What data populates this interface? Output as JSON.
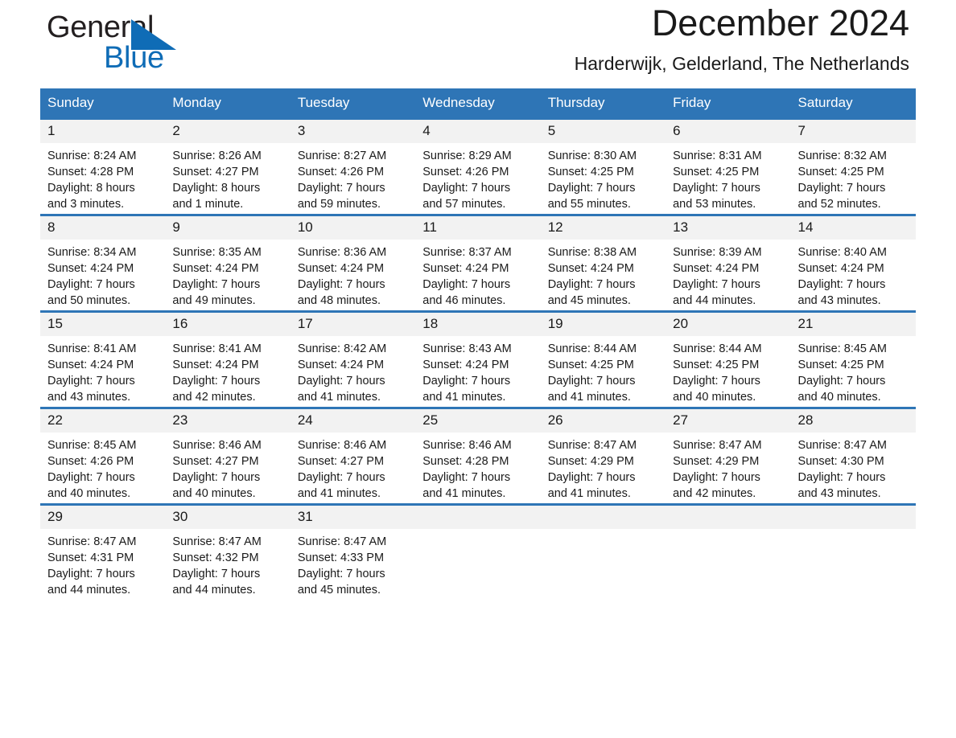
{
  "brand": {
    "line1": "General",
    "line2": "Blue",
    "triangle_color": "#0f6cb6",
    "text_color": "#231f20"
  },
  "header": {
    "title": "December 2024",
    "location": "Harderwijk, Gelderland, The Netherlands"
  },
  "theme": {
    "header_blue": "#2e75b6",
    "daynum_bg": "#f2f2f2",
    "text": "#1a1a1a"
  },
  "weekdays": [
    "Sunday",
    "Monday",
    "Tuesday",
    "Wednesday",
    "Thursday",
    "Friday",
    "Saturday"
  ],
  "weeks": [
    [
      {
        "day": "1",
        "sunrise": "Sunrise: 8:24 AM",
        "sunset": "Sunset: 4:28 PM",
        "daylight1": "Daylight: 8 hours",
        "daylight2": "and 3 minutes."
      },
      {
        "day": "2",
        "sunrise": "Sunrise: 8:26 AM",
        "sunset": "Sunset: 4:27 PM",
        "daylight1": "Daylight: 8 hours",
        "daylight2": "and 1 minute."
      },
      {
        "day": "3",
        "sunrise": "Sunrise: 8:27 AM",
        "sunset": "Sunset: 4:26 PM",
        "daylight1": "Daylight: 7 hours",
        "daylight2": "and 59 minutes."
      },
      {
        "day": "4",
        "sunrise": "Sunrise: 8:29 AM",
        "sunset": "Sunset: 4:26 PM",
        "daylight1": "Daylight: 7 hours",
        "daylight2": "and 57 minutes."
      },
      {
        "day": "5",
        "sunrise": "Sunrise: 8:30 AM",
        "sunset": "Sunset: 4:25 PM",
        "daylight1": "Daylight: 7 hours",
        "daylight2": "and 55 minutes."
      },
      {
        "day": "6",
        "sunrise": "Sunrise: 8:31 AM",
        "sunset": "Sunset: 4:25 PM",
        "daylight1": "Daylight: 7 hours",
        "daylight2": "and 53 minutes."
      },
      {
        "day": "7",
        "sunrise": "Sunrise: 8:32 AM",
        "sunset": "Sunset: 4:25 PM",
        "daylight1": "Daylight: 7 hours",
        "daylight2": "and 52 minutes."
      }
    ],
    [
      {
        "day": "8",
        "sunrise": "Sunrise: 8:34 AM",
        "sunset": "Sunset: 4:24 PM",
        "daylight1": "Daylight: 7 hours",
        "daylight2": "and 50 minutes."
      },
      {
        "day": "9",
        "sunrise": "Sunrise: 8:35 AM",
        "sunset": "Sunset: 4:24 PM",
        "daylight1": "Daylight: 7 hours",
        "daylight2": "and 49 minutes."
      },
      {
        "day": "10",
        "sunrise": "Sunrise: 8:36 AM",
        "sunset": "Sunset: 4:24 PM",
        "daylight1": "Daylight: 7 hours",
        "daylight2": "and 48 minutes."
      },
      {
        "day": "11",
        "sunrise": "Sunrise: 8:37 AM",
        "sunset": "Sunset: 4:24 PM",
        "daylight1": "Daylight: 7 hours",
        "daylight2": "and 46 minutes."
      },
      {
        "day": "12",
        "sunrise": "Sunrise: 8:38 AM",
        "sunset": "Sunset: 4:24 PM",
        "daylight1": "Daylight: 7 hours",
        "daylight2": "and 45 minutes."
      },
      {
        "day": "13",
        "sunrise": "Sunrise: 8:39 AM",
        "sunset": "Sunset: 4:24 PM",
        "daylight1": "Daylight: 7 hours",
        "daylight2": "and 44 minutes."
      },
      {
        "day": "14",
        "sunrise": "Sunrise: 8:40 AM",
        "sunset": "Sunset: 4:24 PM",
        "daylight1": "Daylight: 7 hours",
        "daylight2": "and 43 minutes."
      }
    ],
    [
      {
        "day": "15",
        "sunrise": "Sunrise: 8:41 AM",
        "sunset": "Sunset: 4:24 PM",
        "daylight1": "Daylight: 7 hours",
        "daylight2": "and 43 minutes."
      },
      {
        "day": "16",
        "sunrise": "Sunrise: 8:41 AM",
        "sunset": "Sunset: 4:24 PM",
        "daylight1": "Daylight: 7 hours",
        "daylight2": "and 42 minutes."
      },
      {
        "day": "17",
        "sunrise": "Sunrise: 8:42 AM",
        "sunset": "Sunset: 4:24 PM",
        "daylight1": "Daylight: 7 hours",
        "daylight2": "and 41 minutes."
      },
      {
        "day": "18",
        "sunrise": "Sunrise: 8:43 AM",
        "sunset": "Sunset: 4:24 PM",
        "daylight1": "Daylight: 7 hours",
        "daylight2": "and 41 minutes."
      },
      {
        "day": "19",
        "sunrise": "Sunrise: 8:44 AM",
        "sunset": "Sunset: 4:25 PM",
        "daylight1": "Daylight: 7 hours",
        "daylight2": "and 41 minutes."
      },
      {
        "day": "20",
        "sunrise": "Sunrise: 8:44 AM",
        "sunset": "Sunset: 4:25 PM",
        "daylight1": "Daylight: 7 hours",
        "daylight2": "and 40 minutes."
      },
      {
        "day": "21",
        "sunrise": "Sunrise: 8:45 AM",
        "sunset": "Sunset: 4:25 PM",
        "daylight1": "Daylight: 7 hours",
        "daylight2": "and 40 minutes."
      }
    ],
    [
      {
        "day": "22",
        "sunrise": "Sunrise: 8:45 AM",
        "sunset": "Sunset: 4:26 PM",
        "daylight1": "Daylight: 7 hours",
        "daylight2": "and 40 minutes."
      },
      {
        "day": "23",
        "sunrise": "Sunrise: 8:46 AM",
        "sunset": "Sunset: 4:27 PM",
        "daylight1": "Daylight: 7 hours",
        "daylight2": "and 40 minutes."
      },
      {
        "day": "24",
        "sunrise": "Sunrise: 8:46 AM",
        "sunset": "Sunset: 4:27 PM",
        "daylight1": "Daylight: 7 hours",
        "daylight2": "and 41 minutes."
      },
      {
        "day": "25",
        "sunrise": "Sunrise: 8:46 AM",
        "sunset": "Sunset: 4:28 PM",
        "daylight1": "Daylight: 7 hours",
        "daylight2": "and 41 minutes."
      },
      {
        "day": "26",
        "sunrise": "Sunrise: 8:47 AM",
        "sunset": "Sunset: 4:29 PM",
        "daylight1": "Daylight: 7 hours",
        "daylight2": "and 41 minutes."
      },
      {
        "day": "27",
        "sunrise": "Sunrise: 8:47 AM",
        "sunset": "Sunset: 4:29 PM",
        "daylight1": "Daylight: 7 hours",
        "daylight2": "and 42 minutes."
      },
      {
        "day": "28",
        "sunrise": "Sunrise: 8:47 AM",
        "sunset": "Sunset: 4:30 PM",
        "daylight1": "Daylight: 7 hours",
        "daylight2": "and 43 minutes."
      }
    ],
    [
      {
        "day": "29",
        "sunrise": "Sunrise: 8:47 AM",
        "sunset": "Sunset: 4:31 PM",
        "daylight1": "Daylight: 7 hours",
        "daylight2": "and 44 minutes."
      },
      {
        "day": "30",
        "sunrise": "Sunrise: 8:47 AM",
        "sunset": "Sunset: 4:32 PM",
        "daylight1": "Daylight: 7 hours",
        "daylight2": "and 44 minutes."
      },
      {
        "day": "31",
        "sunrise": "Sunrise: 8:47 AM",
        "sunset": "Sunset: 4:33 PM",
        "daylight1": "Daylight: 7 hours",
        "daylight2": "and 45 minutes."
      },
      {
        "day": "",
        "sunrise": "",
        "sunset": "",
        "daylight1": "",
        "daylight2": ""
      },
      {
        "day": "",
        "sunrise": "",
        "sunset": "",
        "daylight1": "",
        "daylight2": ""
      },
      {
        "day": "",
        "sunrise": "",
        "sunset": "",
        "daylight1": "",
        "daylight2": ""
      },
      {
        "day": "",
        "sunrise": "",
        "sunset": "",
        "daylight1": "",
        "daylight2": ""
      }
    ]
  ]
}
